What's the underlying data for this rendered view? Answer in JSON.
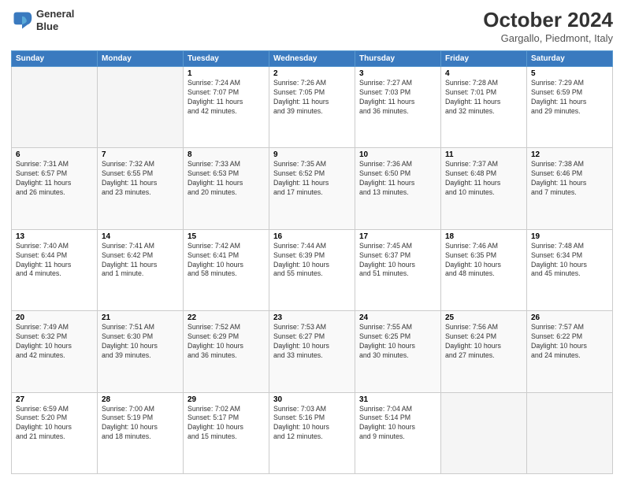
{
  "header": {
    "logo_line1": "General",
    "logo_line2": "Blue",
    "title": "October 2024",
    "subtitle": "Gargallo, Piedmont, Italy"
  },
  "weekdays": [
    "Sunday",
    "Monday",
    "Tuesday",
    "Wednesday",
    "Thursday",
    "Friday",
    "Saturday"
  ],
  "weeks": [
    [
      {
        "day": "",
        "info": ""
      },
      {
        "day": "",
        "info": ""
      },
      {
        "day": "1",
        "info": "Sunrise: 7:24 AM\nSunset: 7:07 PM\nDaylight: 11 hours\nand 42 minutes."
      },
      {
        "day": "2",
        "info": "Sunrise: 7:26 AM\nSunset: 7:05 PM\nDaylight: 11 hours\nand 39 minutes."
      },
      {
        "day": "3",
        "info": "Sunrise: 7:27 AM\nSunset: 7:03 PM\nDaylight: 11 hours\nand 36 minutes."
      },
      {
        "day": "4",
        "info": "Sunrise: 7:28 AM\nSunset: 7:01 PM\nDaylight: 11 hours\nand 32 minutes."
      },
      {
        "day": "5",
        "info": "Sunrise: 7:29 AM\nSunset: 6:59 PM\nDaylight: 11 hours\nand 29 minutes."
      }
    ],
    [
      {
        "day": "6",
        "info": "Sunrise: 7:31 AM\nSunset: 6:57 PM\nDaylight: 11 hours\nand 26 minutes."
      },
      {
        "day": "7",
        "info": "Sunrise: 7:32 AM\nSunset: 6:55 PM\nDaylight: 11 hours\nand 23 minutes."
      },
      {
        "day": "8",
        "info": "Sunrise: 7:33 AM\nSunset: 6:53 PM\nDaylight: 11 hours\nand 20 minutes."
      },
      {
        "day": "9",
        "info": "Sunrise: 7:35 AM\nSunset: 6:52 PM\nDaylight: 11 hours\nand 17 minutes."
      },
      {
        "day": "10",
        "info": "Sunrise: 7:36 AM\nSunset: 6:50 PM\nDaylight: 11 hours\nand 13 minutes."
      },
      {
        "day": "11",
        "info": "Sunrise: 7:37 AM\nSunset: 6:48 PM\nDaylight: 11 hours\nand 10 minutes."
      },
      {
        "day": "12",
        "info": "Sunrise: 7:38 AM\nSunset: 6:46 PM\nDaylight: 11 hours\nand 7 minutes."
      }
    ],
    [
      {
        "day": "13",
        "info": "Sunrise: 7:40 AM\nSunset: 6:44 PM\nDaylight: 11 hours\nand 4 minutes."
      },
      {
        "day": "14",
        "info": "Sunrise: 7:41 AM\nSunset: 6:42 PM\nDaylight: 11 hours\nand 1 minute."
      },
      {
        "day": "15",
        "info": "Sunrise: 7:42 AM\nSunset: 6:41 PM\nDaylight: 10 hours\nand 58 minutes."
      },
      {
        "day": "16",
        "info": "Sunrise: 7:44 AM\nSunset: 6:39 PM\nDaylight: 10 hours\nand 55 minutes."
      },
      {
        "day": "17",
        "info": "Sunrise: 7:45 AM\nSunset: 6:37 PM\nDaylight: 10 hours\nand 51 minutes."
      },
      {
        "day": "18",
        "info": "Sunrise: 7:46 AM\nSunset: 6:35 PM\nDaylight: 10 hours\nand 48 minutes."
      },
      {
        "day": "19",
        "info": "Sunrise: 7:48 AM\nSunset: 6:34 PM\nDaylight: 10 hours\nand 45 minutes."
      }
    ],
    [
      {
        "day": "20",
        "info": "Sunrise: 7:49 AM\nSunset: 6:32 PM\nDaylight: 10 hours\nand 42 minutes."
      },
      {
        "day": "21",
        "info": "Sunrise: 7:51 AM\nSunset: 6:30 PM\nDaylight: 10 hours\nand 39 minutes."
      },
      {
        "day": "22",
        "info": "Sunrise: 7:52 AM\nSunset: 6:29 PM\nDaylight: 10 hours\nand 36 minutes."
      },
      {
        "day": "23",
        "info": "Sunrise: 7:53 AM\nSunset: 6:27 PM\nDaylight: 10 hours\nand 33 minutes."
      },
      {
        "day": "24",
        "info": "Sunrise: 7:55 AM\nSunset: 6:25 PM\nDaylight: 10 hours\nand 30 minutes."
      },
      {
        "day": "25",
        "info": "Sunrise: 7:56 AM\nSunset: 6:24 PM\nDaylight: 10 hours\nand 27 minutes."
      },
      {
        "day": "26",
        "info": "Sunrise: 7:57 AM\nSunset: 6:22 PM\nDaylight: 10 hours\nand 24 minutes."
      }
    ],
    [
      {
        "day": "27",
        "info": "Sunrise: 6:59 AM\nSunset: 5:20 PM\nDaylight: 10 hours\nand 21 minutes."
      },
      {
        "day": "28",
        "info": "Sunrise: 7:00 AM\nSunset: 5:19 PM\nDaylight: 10 hours\nand 18 minutes."
      },
      {
        "day": "29",
        "info": "Sunrise: 7:02 AM\nSunset: 5:17 PM\nDaylight: 10 hours\nand 15 minutes."
      },
      {
        "day": "30",
        "info": "Sunrise: 7:03 AM\nSunset: 5:16 PM\nDaylight: 10 hours\nand 12 minutes."
      },
      {
        "day": "31",
        "info": "Sunrise: 7:04 AM\nSunset: 5:14 PM\nDaylight: 10 hours\nand 9 minutes."
      },
      {
        "day": "",
        "info": ""
      },
      {
        "day": "",
        "info": ""
      }
    ]
  ]
}
